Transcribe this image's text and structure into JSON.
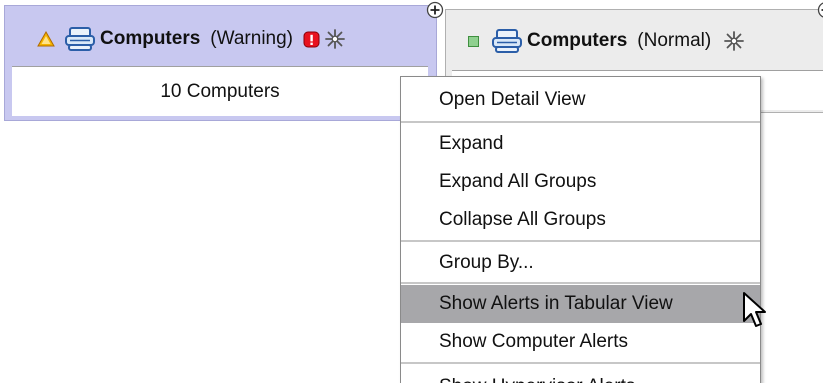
{
  "groups": [
    {
      "name": "Computers",
      "status": "(Warning)",
      "body_text": "10 Computers",
      "status_icon": "warning-triangle-icon",
      "accent_color": "#c8c8f0"
    },
    {
      "name": "Computers",
      "status": "(Normal)",
      "status_icon": "normal-square-icon",
      "accent_color": "#ececec"
    }
  ],
  "context_menu": {
    "items": [
      {
        "label": "Open Detail View"
      },
      {
        "label": "Expand"
      },
      {
        "label": "Expand All Groups"
      },
      {
        "label": "Collapse All Groups"
      },
      {
        "label": "Group By..."
      },
      {
        "label": "Show Alerts in Tabular View",
        "highlighted": true
      },
      {
        "label": "Show Computer Alerts"
      },
      {
        "label": "Show Hypervisor Alerts"
      }
    ],
    "highlight_color": "#a7a7aa"
  }
}
